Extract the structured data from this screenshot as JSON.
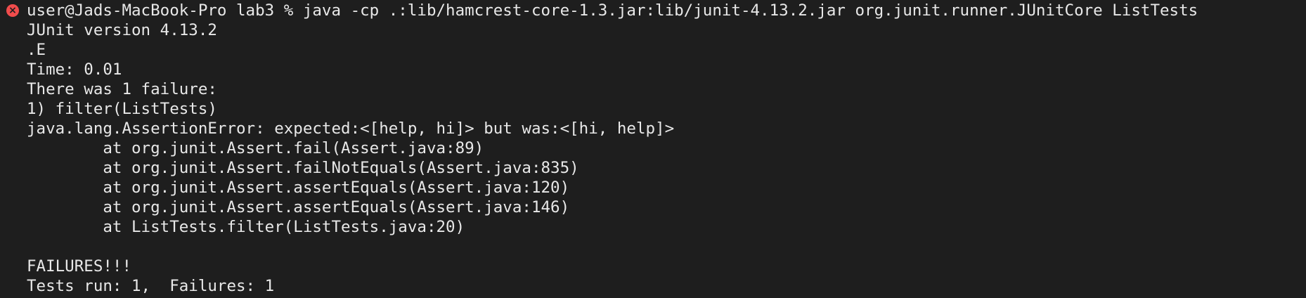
{
  "terminal": {
    "status_icon": "error-circle-icon",
    "status_color": "#f14c4c",
    "background": "#1e1e1e",
    "command": "user@Jads-MacBook-Pro lab3 % java -cp .:lib/hamcrest-core-1.3.jar:lib/junit-4.13.2.jar org.junit.runner.JUnitCore ListTests",
    "output": [
      "JUnit version 4.13.2",
      ".E",
      "Time: 0.01",
      "There was 1 failure:",
      "1) filter(ListTests)",
      "java.lang.AssertionError: expected:<[help, hi]> but was:<[hi, help]>",
      "        at org.junit.Assert.fail(Assert.java:89)",
      "        at org.junit.Assert.failNotEquals(Assert.java:835)",
      "        at org.junit.Assert.assertEquals(Assert.java:120)",
      "        at org.junit.Assert.assertEquals(Assert.java:146)",
      "        at ListTests.filter(ListTests.java:20)",
      "",
      "FAILURES!!!",
      "Tests run: 1,  Failures: 1"
    ]
  }
}
